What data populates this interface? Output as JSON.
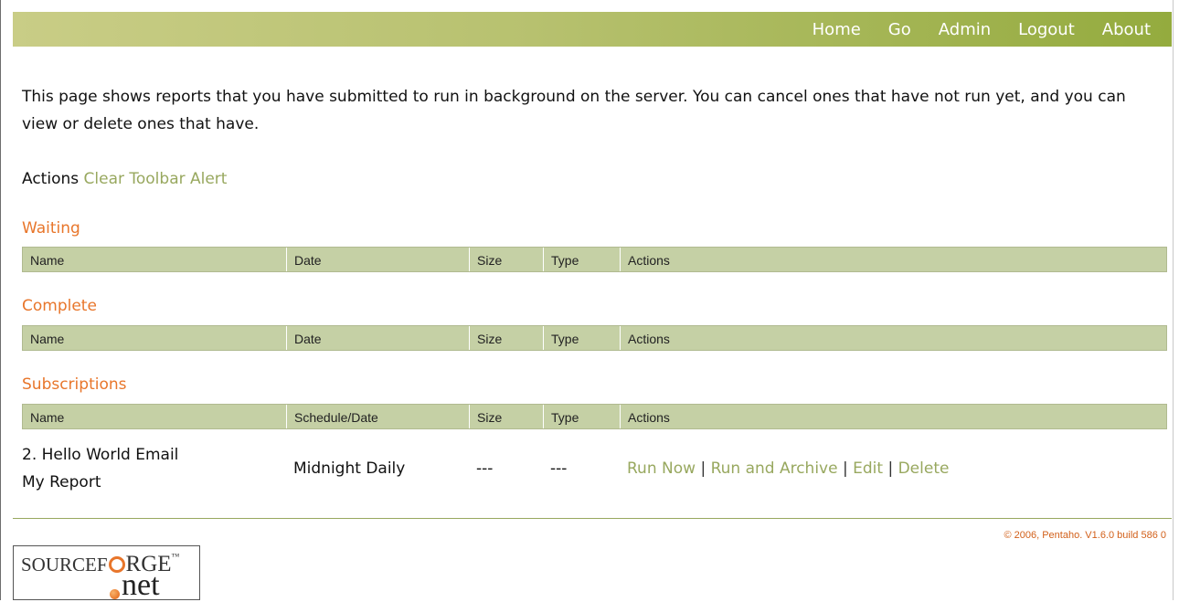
{
  "nav": {
    "items": [
      "Home",
      "Go",
      "Admin",
      "Logout",
      "About"
    ]
  },
  "intro": {
    "text": "This page shows reports that you have submitted to run in background on the server. You can cancel ones that have not run yet, and you can view or delete ones that have."
  },
  "actions": {
    "label": "Actions",
    "clear_toolbar_alert": "Clear Toolbar Alert"
  },
  "sections": {
    "waiting": {
      "title": "Waiting",
      "columns": [
        "Name",
        "Date",
        "Size",
        "Type",
        "Actions"
      ]
    },
    "complete": {
      "title": "Complete",
      "columns": [
        "Name",
        "Date",
        "Size",
        "Type",
        "Actions"
      ]
    },
    "subscriptions": {
      "title": "Subscriptions",
      "columns": [
        "Name",
        "Schedule/Date",
        "Size",
        "Type",
        "Actions"
      ],
      "rows": [
        {
          "name_line1": "2. Hello World Email",
          "name_line2": "My Report",
          "schedule": "Midnight Daily",
          "size": "---",
          "type": "---",
          "actions": [
            "Run Now",
            "Run and Archive",
            "Edit",
            "Delete"
          ],
          "separator": "|"
        }
      ]
    }
  },
  "footer": {
    "copyright": "© 2006, Pentaho. V1.6.0 build 586 0"
  },
  "logo": {
    "text_left": "SOURCEF",
    "text_right": "RGE",
    "tm": "™",
    "net": "net"
  },
  "colors": {
    "accent_green": "#98a85f",
    "section_orange": "#e8762b",
    "header_fill": "#c5d0a5"
  }
}
